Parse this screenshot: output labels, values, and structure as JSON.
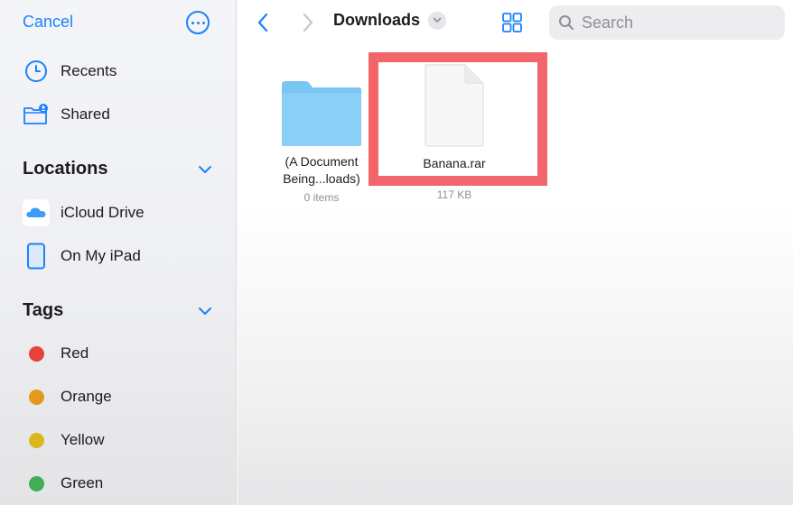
{
  "sidebar": {
    "cancel_label": "Cancel",
    "favorites": [
      {
        "label": "Recents",
        "icon": "clock-icon"
      },
      {
        "label": "Shared",
        "icon": "shared-folder-icon"
      }
    ],
    "locations": {
      "title": "Locations",
      "items": [
        {
          "label": "iCloud Drive",
          "icon": "icloud-icon"
        },
        {
          "label": "On My iPad",
          "icon": "ipad-icon"
        }
      ]
    },
    "tags": {
      "title": "Tags",
      "items": [
        {
          "label": "Red",
          "color": "#e5433c"
        },
        {
          "label": "Orange",
          "color": "#e39a1a"
        },
        {
          "label": "Yellow",
          "color": "#dcb71c"
        },
        {
          "label": "Green",
          "color": "#3fae56"
        }
      ]
    }
  },
  "toolbar": {
    "title": "Downloads",
    "search_placeholder": "Search"
  },
  "items": [
    {
      "name_line1": "(A Document",
      "name_line2": "Being...loads)",
      "meta": "0 items",
      "type": "folder"
    },
    {
      "name_line1": "Banana.rar",
      "meta": "117 KB",
      "type": "file"
    }
  ],
  "colors": {
    "accent": "#1a82fb",
    "highlight": "#f2656a",
    "folder": "#8ad0f6"
  }
}
